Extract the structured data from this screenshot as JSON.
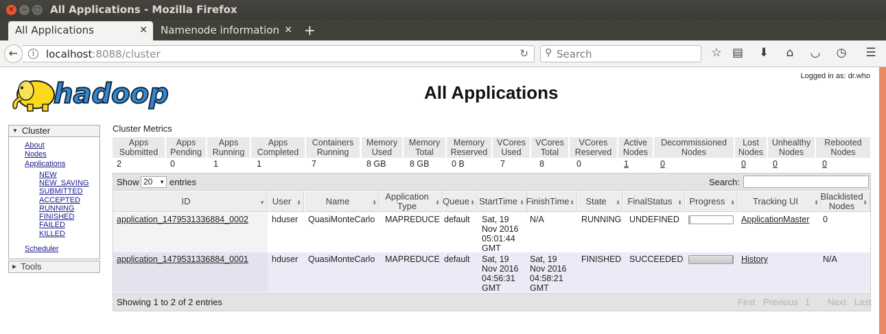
{
  "window": {
    "title": "All Applications - Mozilla Firefox"
  },
  "tabs": [
    {
      "label": "All Applications"
    },
    {
      "label": "Namenode information"
    }
  ],
  "nav": {
    "url_host": "localhost",
    "url_rest": ":8088/cluster",
    "search_placeholder": "Search"
  },
  "page": {
    "logged_in": "Logged in as: dr.who",
    "title": "All Applications",
    "logo_text": "hadoop"
  },
  "sidebar": {
    "cluster_label": "Cluster",
    "tools_label": "Tools",
    "links": [
      "About",
      "Nodes",
      "Applications"
    ],
    "states": [
      "NEW",
      "NEW_SAVING",
      "SUBMITTED",
      "ACCEPTED",
      "RUNNING",
      "FINISHED",
      "FAILED",
      "KILLED"
    ],
    "scheduler": "Scheduler"
  },
  "metrics": {
    "title": "Cluster Metrics",
    "headers": [
      [
        "Apps",
        "Submitted"
      ],
      [
        "Apps",
        "Pending"
      ],
      [
        "Apps",
        "Running"
      ],
      [
        "Apps",
        "Completed"
      ],
      [
        "Containers",
        "Running"
      ],
      [
        "Memory",
        "Used"
      ],
      [
        "Memory",
        "Total"
      ],
      [
        "Memory",
        "Reserved"
      ],
      [
        "VCores",
        "Used"
      ],
      [
        "VCores",
        "Total"
      ],
      [
        "VCores",
        "Reserved"
      ],
      [
        "Active",
        "Nodes"
      ],
      [
        "Decommissioned",
        "Nodes"
      ],
      [
        "Lost",
        "Nodes"
      ],
      [
        "Unhealthy",
        "Nodes"
      ],
      [
        "Rebooted",
        "Nodes"
      ]
    ],
    "values": [
      "2",
      "0",
      "1",
      "1",
      "7",
      "8 GB",
      "8 GB",
      "0 B",
      "7",
      "8",
      "0",
      "1",
      "0",
      "0",
      "0",
      "0"
    ]
  },
  "table": {
    "show_label": "Show",
    "page_size": "20",
    "entries_label": "entries",
    "search_label": "Search:",
    "columns": [
      [
        "ID"
      ],
      [
        "User"
      ],
      [
        "Name"
      ],
      [
        "Application",
        "Type"
      ],
      [
        "Queue"
      ],
      [
        "StartTime"
      ],
      [
        "FinishTime"
      ],
      [
        "State"
      ],
      [
        "FinalStatus"
      ],
      [
        "Progress"
      ],
      [
        "Tracking UI"
      ],
      [
        "Blacklisted",
        "Nodes"
      ]
    ],
    "rows": [
      {
        "id": "application_1479531336884_0002",
        "user": "hduser",
        "name": "QuasiMonteCarlo",
        "type": "MAPREDUCE",
        "queue": "default",
        "start": [
          "Sat, 19",
          "Nov 2016",
          "05:01:44",
          "GMT"
        ],
        "finish": [
          "N/A"
        ],
        "state": "RUNNING",
        "final": "UNDEFINED",
        "progress": 0.03,
        "tracking": "ApplicationMaster",
        "blacklisted": "0"
      },
      {
        "id": "application_1479531336884_0001",
        "user": "hduser",
        "name": "QuasiMonteCarlo",
        "type": "MAPREDUCE",
        "queue": "default",
        "start": [
          "Sat, 19",
          "Nov 2016",
          "04:56:31",
          "GMT"
        ],
        "finish": [
          "Sat, 19",
          "Nov 2016",
          "04:58:21",
          "GMT"
        ],
        "state": "FINISHED",
        "final": "SUCCEEDED",
        "progress": 1.0,
        "tracking": "History",
        "blacklisted": "N/A"
      }
    ],
    "showing": "Showing 1 to 2 of 2 entries",
    "pager": [
      "First",
      "Previous",
      "1",
      "Next",
      "Last"
    ]
  },
  "colors": {
    "accent_scroll": "#e88a63",
    "logo_yellow": "#fbd81b",
    "logo_blue": "#3a87c8"
  }
}
